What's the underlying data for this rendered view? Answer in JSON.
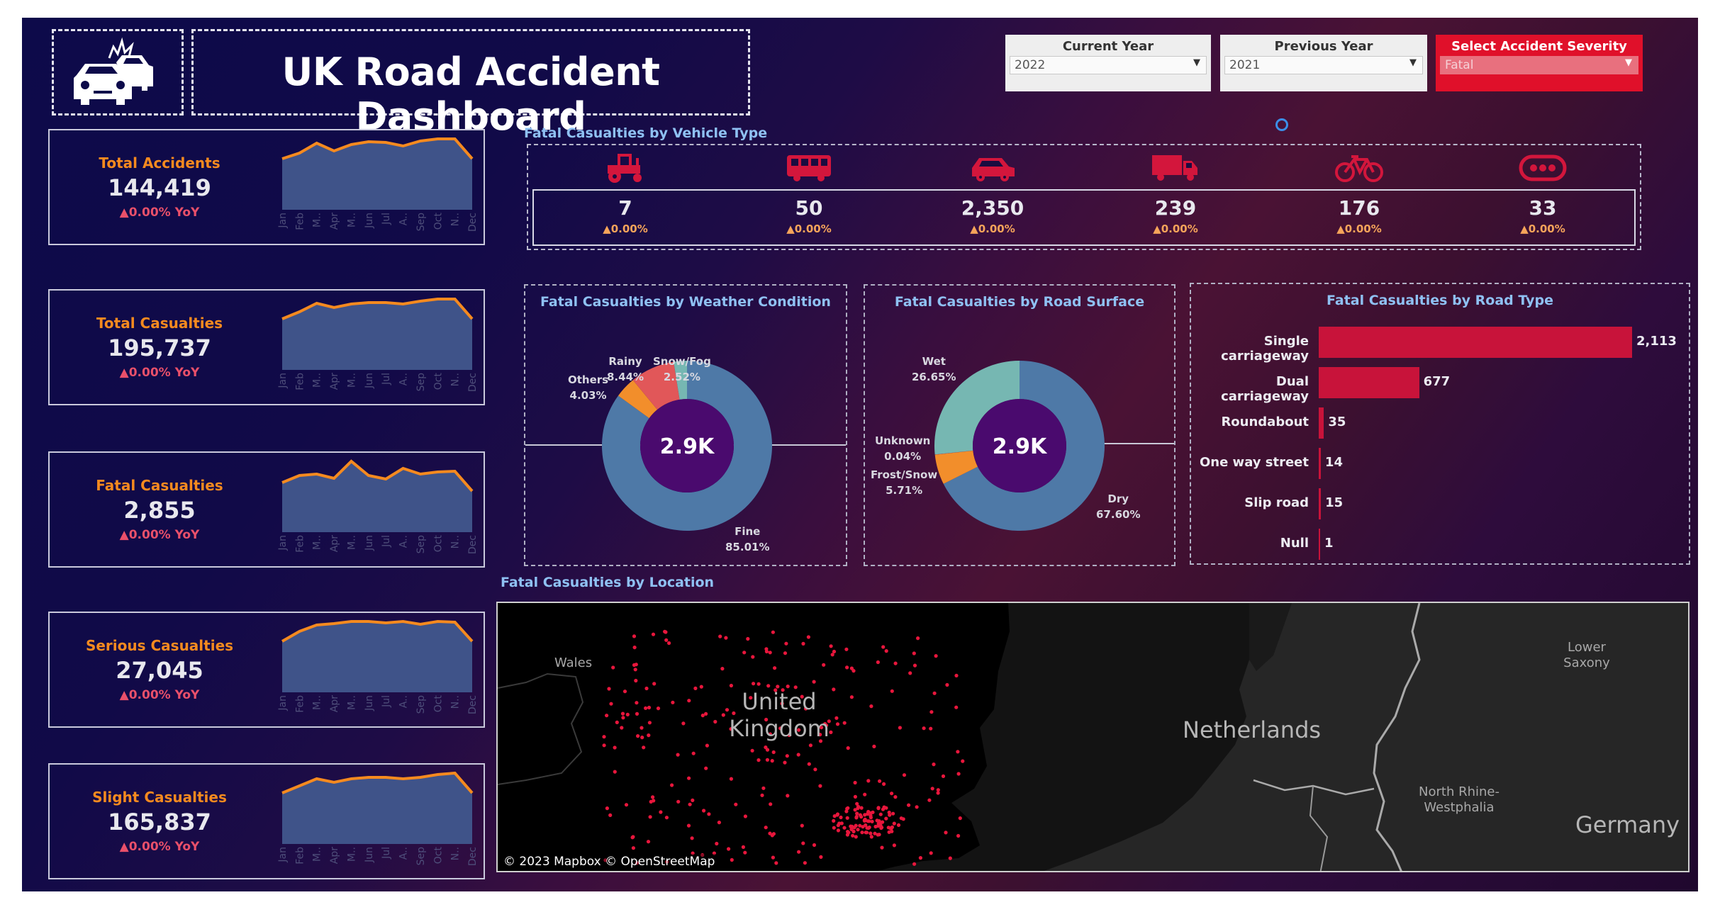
{
  "header": {
    "title": "UK Road Accident Dashboard",
    "logo_icon": "car-crash-icon"
  },
  "filters": {
    "current_year": {
      "label": "Current Year",
      "value": "2022"
    },
    "previous_year": {
      "label": "Previous Year",
      "value": "2021"
    },
    "severity": {
      "label": "Select Accident Severity",
      "value": "Fatal"
    }
  },
  "kpis": [
    {
      "label": "Total Accidents",
      "value": "144,419",
      "yoy": "▲0.00% YoY",
      "trend": [
        0.72,
        0.8,
        0.94,
        0.83,
        0.92,
        0.96,
        0.95,
        0.9,
        0.97,
        1.0,
        1.0,
        0.72
      ]
    },
    {
      "label": "Total Casualties",
      "value": "195,737",
      "yoy": "▲0.00% YoY",
      "trend": [
        0.72,
        0.82,
        0.94,
        0.88,
        0.93,
        0.95,
        0.95,
        0.93,
        0.97,
        1.0,
        1.0,
        0.72
      ]
    },
    {
      "label": "Fatal Casualties",
      "value": "2,855",
      "yoy": "▲0.00% YoY",
      "trend": [
        0.7,
        0.8,
        0.82,
        0.76,
        1.0,
        0.8,
        0.75,
        0.9,
        0.82,
        0.85,
        0.86,
        0.58
      ]
    },
    {
      "label": "Serious Casualties",
      "value": "27,045",
      "yoy": "▲0.00% YoY",
      "trend": [
        0.72,
        0.86,
        0.95,
        0.97,
        1.0,
        1.0,
        0.98,
        1.0,
        0.96,
        1.0,
        0.99,
        0.72
      ]
    },
    {
      "label": "Slight Casualties",
      "value": "165,837",
      "yoy": "▲0.00% YoY",
      "trend": [
        0.72,
        0.82,
        0.92,
        0.87,
        0.92,
        0.94,
        0.94,
        0.92,
        0.94,
        0.98,
        1.0,
        0.72
      ]
    }
  ],
  "months": [
    "Jan",
    "Feb",
    "M..",
    "Apr",
    "M..",
    "Jun",
    "Jul",
    "A..",
    "Sep",
    "Oct",
    "N..",
    "Dec"
  ],
  "vehicle": {
    "title": "Fatal Casualties by Vehicle Type",
    "items": [
      {
        "icon": "tractor-icon",
        "value": "7",
        "yoy": "▲0.00%"
      },
      {
        "icon": "bus-icon",
        "value": "50",
        "yoy": "▲0.00%"
      },
      {
        "icon": "car-icon",
        "value": "2,350",
        "yoy": "▲0.00%"
      },
      {
        "icon": "truck-icon",
        "value": "239",
        "yoy": "▲0.00%"
      },
      {
        "icon": "bicycle-icon",
        "value": "176",
        "yoy": "▲0.00%"
      },
      {
        "icon": "more-icon",
        "value": "33",
        "yoy": "▲0.00%"
      }
    ]
  },
  "weather": {
    "title": "Fatal Casualties by Weather Condition",
    "center": "2.9K",
    "slices": [
      {
        "name": "Fine",
        "pct": "85.01%",
        "value": 85.01,
        "color": "#4e79a7"
      },
      {
        "name": "Others",
        "pct": "4.03%",
        "value": 4.03,
        "color": "#f28e2b"
      },
      {
        "name": "Rainy",
        "pct": "8.44%",
        "value": 8.44,
        "color": "#e15759"
      },
      {
        "name": "Snow/Fog",
        "pct": "2.52%",
        "value": 2.52,
        "color": "#76b7b2"
      }
    ]
  },
  "surface": {
    "title": "Fatal Casualties by Road Surface",
    "center": "2.9K",
    "slices": [
      {
        "name": "Dry",
        "pct": "67.60%",
        "value": 67.6,
        "color": "#4e79a7"
      },
      {
        "name": "Frost/Snow",
        "pct": "5.71%",
        "value": 5.71,
        "color": "#f28e2b"
      },
      {
        "name": "Unknown",
        "pct": "0.04%",
        "value": 0.04,
        "color": "#e15759"
      },
      {
        "name": "Wet",
        "pct": "26.65%",
        "value": 26.65,
        "color": "#76b7b2"
      }
    ]
  },
  "road_type": {
    "title": "Fatal Casualties by Road Type",
    "bars": [
      {
        "label": "Single carriageway",
        "value": 2113,
        "display": "2,113"
      },
      {
        "label": "Dual carriageway",
        "value": 677,
        "display": "677"
      },
      {
        "label": "Roundabout",
        "value": 35,
        "display": "35"
      },
      {
        "label": "One way street",
        "value": 14,
        "display": "14"
      },
      {
        "label": "Slip road",
        "value": 15,
        "display": "15"
      },
      {
        "label": "Null",
        "value": 1,
        "display": "1"
      }
    ]
  },
  "location": {
    "title": "Fatal Casualties by Location",
    "labels": {
      "wales": "Wales",
      "uk_line1": "United",
      "uk_line2": "Kingdom",
      "netherlands": "Netherlands",
      "lower_saxony_1": "Lower",
      "lower_saxony_2": "Saxony",
      "nrw_1": "North Rhine-",
      "nrw_2": "Westphalia",
      "germany": "Germany"
    },
    "attribution": "© 2023 Mapbox  © OpenStreetMap"
  },
  "colors": {
    "kpi_label": "#f58a1f",
    "accent_red": "#c8133a",
    "title_blue": "#8fc1f3",
    "area_fill": "#3f5389",
    "line": "#f58a1f",
    "donut_center": "#4a0a6e"
  }
}
